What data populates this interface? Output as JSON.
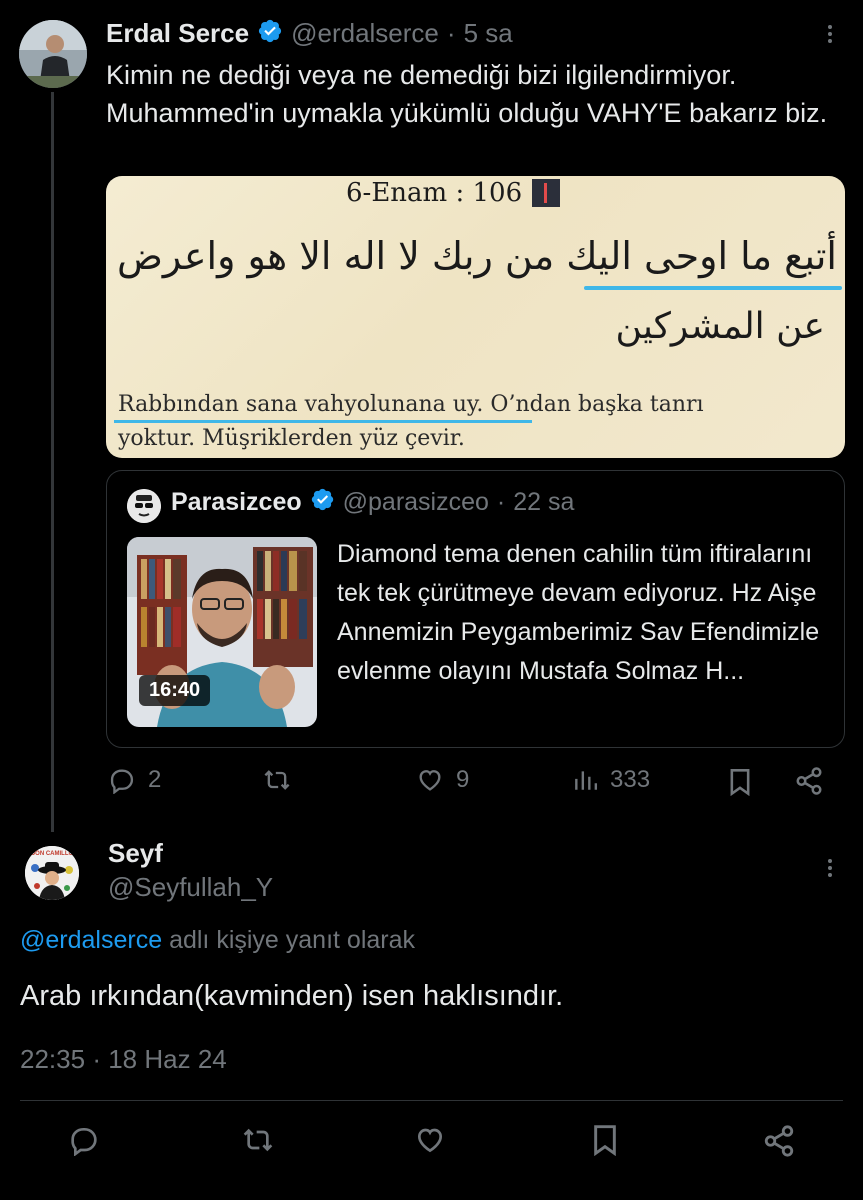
{
  "main_tweet": {
    "author_name": "Erdal Serce",
    "handle": "@erdalserce",
    "separator": "·",
    "time_ago": "5 sa",
    "text": "Kimin ne dediği veya ne demediği bizi ilgilendirmiyor. Muhammed'in uymakla yükümlü olduğu VAHY'E bakarız biz.",
    "image": {
      "title": "6-Enam : 106",
      "arabic_line1": "أتبع ما اوحى اليك من ربك لا اله الا هو واعرض",
      "arabic_line2": "عن المشركين",
      "translation_line1": "Rabbından sana vahyolunana uy. O’ndan başka tanrı",
      "translation_line2": "yoktur. Müşriklerden yüz çevir."
    },
    "quote": {
      "author_name": "Parasizceo",
      "handle": "@parasizceo",
      "separator": "·",
      "time_ago": "22 sa",
      "video_duration": "16:40",
      "text": "Diamond tema denen cahilin tüm iftiralarını tek tek çürütmeye devam ediyoruz. Hz Aişe Annemizin Peygamberimiz Sav Efendimizle evlenme olayını Mustafa Solmaz H..."
    },
    "actions": {
      "replies": "2",
      "retweets": "",
      "likes": "9",
      "views": "333"
    }
  },
  "reply_tweet": {
    "author_name": "Seyf",
    "handle": "@Seyfullah_Y",
    "avatar_caption": "DON CAMILLO",
    "reply_to_handle": "@erdalserce",
    "reply_to_suffix": "adlı kişiye yanıt olarak",
    "text": "Arab ırkından(kavminden) isen haklısındır.",
    "timestamp_time": "22:35",
    "timestamp_separator": "·",
    "timestamp_date": "18 Haz 24"
  },
  "colors": {
    "background": "#000000",
    "text": "#e7e9ea",
    "muted": "#71767b",
    "link": "#1d9bf0",
    "verified": "#1d9bf0",
    "border": "#2f3336"
  }
}
